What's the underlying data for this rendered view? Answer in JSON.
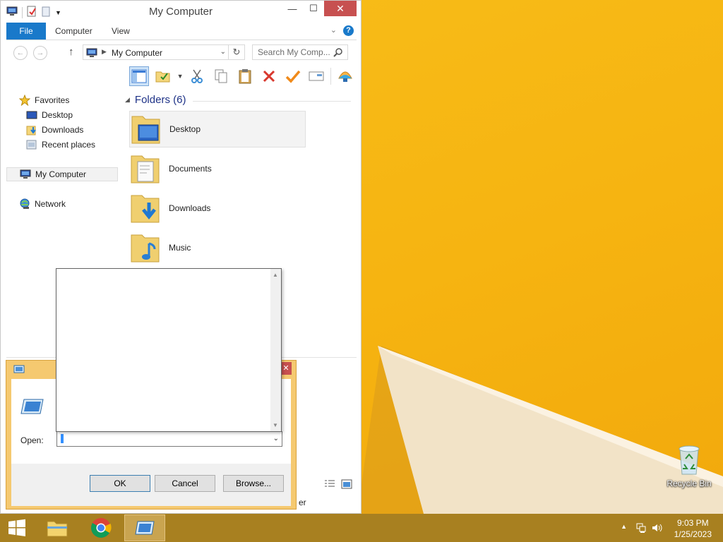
{
  "explorer": {
    "title": "My Computer",
    "tabs": {
      "file": "File",
      "computer": "Computer",
      "view": "View"
    },
    "address": {
      "path": "My Computer"
    },
    "search": {
      "placeholder": "Search My Comp..."
    },
    "nav": {
      "favorites": "Favorites",
      "desktop": "Desktop",
      "downloads": "Downloads",
      "recent": "Recent places",
      "mycomputer": "My Computer",
      "network": "Network"
    },
    "content": {
      "group_header": "Folders (6)",
      "folders": [
        "Desktop",
        "Documents",
        "Downloads",
        "Music"
      ]
    },
    "status_tail": "er"
  },
  "run_dialog": {
    "open_label": "Open:",
    "open_value": "",
    "ok": "OK",
    "cancel": "Cancel",
    "browse": "Browse..."
  },
  "desktop": {
    "recycle_bin": "Recycle Bin"
  },
  "taskbar": {
    "time": "9:03 PM",
    "date": "1/25/2023"
  },
  "colors": {
    "accent": "#1979ca",
    "wallpaper": "#f6b411",
    "taskbar": "#a88020",
    "run_frame": "#f5c970",
    "close": "#c75050"
  }
}
